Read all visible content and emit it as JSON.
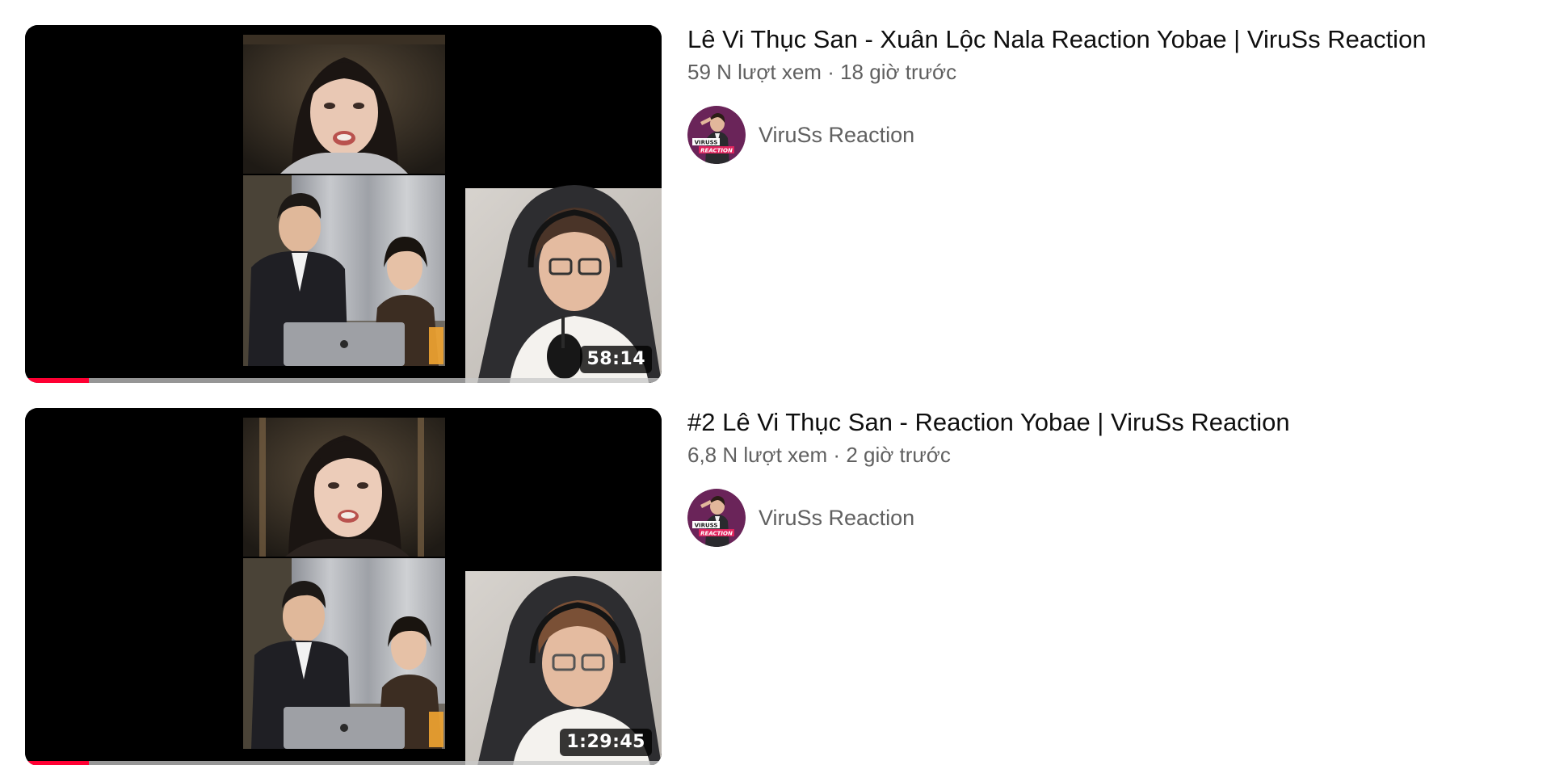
{
  "videos": [
    {
      "title": "Lê Vi Thục San - Xuân Lộc Nala Reaction Yobae | ViruSs Reaction",
      "views": "59 N lượt xem",
      "separator": "·",
      "age": "18 giờ trước",
      "channel": "ViruSs Reaction",
      "duration": "58:14",
      "watched_fraction": 0.1
    },
    {
      "title": "#2 Lê Vi Thục San - Reaction Yobae | ViruSs Reaction",
      "views": "6,8 N lượt xem",
      "separator": "·",
      "age": "2 giờ trước",
      "channel": "ViruSs Reaction",
      "duration": "1:29:45",
      "watched_fraction": 0.1
    }
  ],
  "avatar_logo": {
    "line1": "VIRUSS",
    "line2": "REACTION"
  },
  "colors": {
    "progress": "#ff0033",
    "title": "#0f0f0f",
    "secondary_text": "#606060",
    "avatar_bg": "#5b1f4e"
  }
}
